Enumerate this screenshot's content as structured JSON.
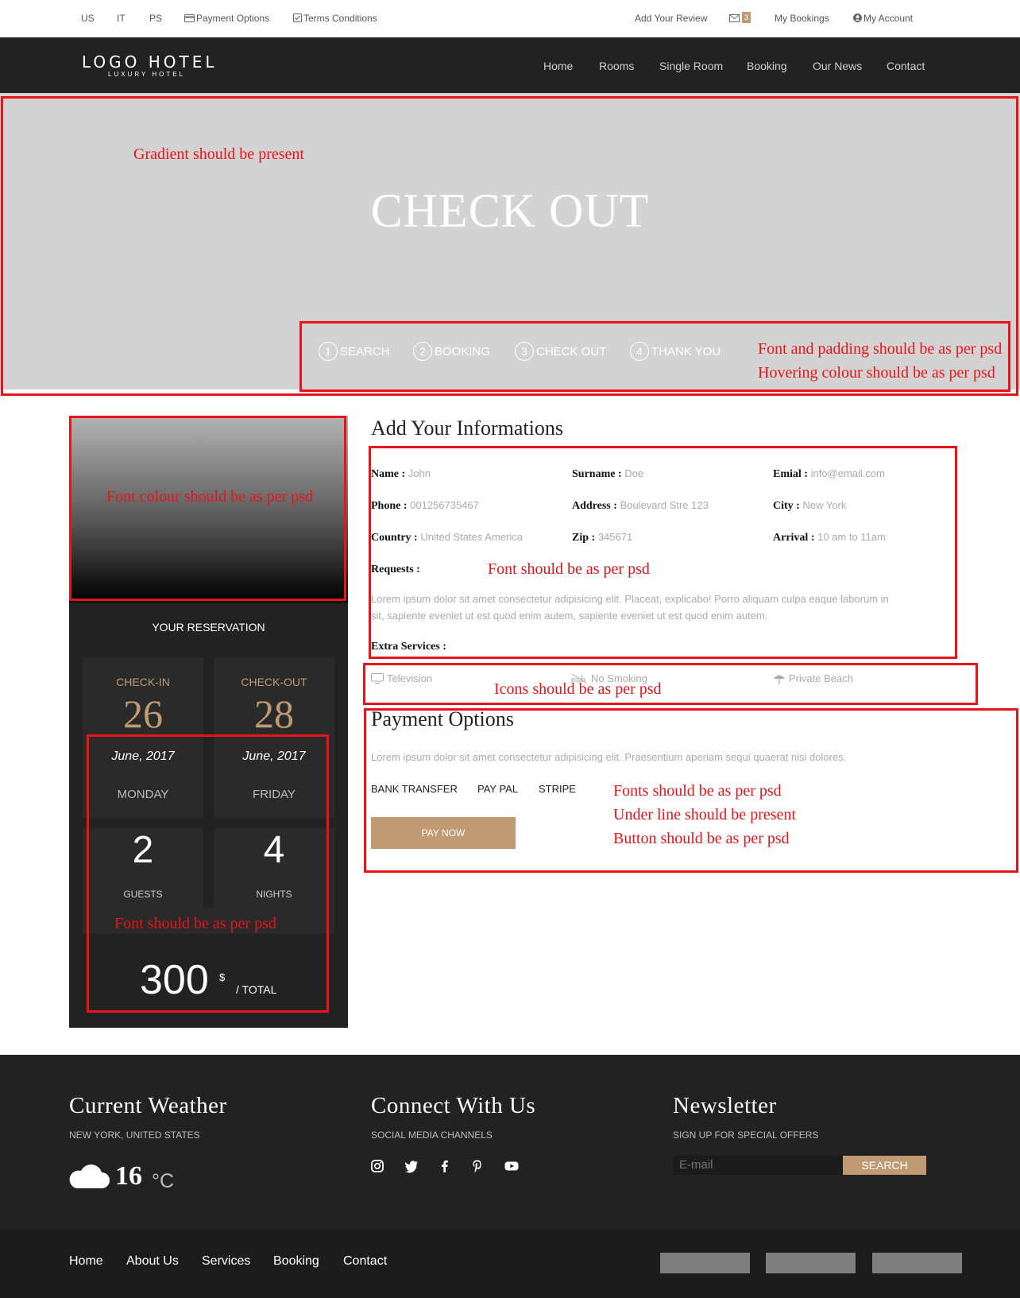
{
  "topbar": {
    "lang_us": "US",
    "lang_it": "IT",
    "lang_ps": "PS",
    "payment_options": "Payment Options",
    "terms": "Terms Conditions",
    "add_review": "Add Your Review",
    "mail_count": "3",
    "my_bookings": "My Bookings",
    "my_account": "My Account"
  },
  "navbar": {
    "logo": "LOGO HOTEL",
    "logo_sub": "LUXURY HOTEL",
    "items": [
      "Home",
      "Rooms",
      "Single Room",
      "Booking",
      "Our News",
      "Contact"
    ]
  },
  "hero": {
    "title": "CHECK OUT",
    "steps": [
      {
        "num": "1",
        "label": "SEARCH"
      },
      {
        "num": "2",
        "label": "BOOKING"
      },
      {
        "num": "3",
        "label": "CHECK OUT"
      },
      {
        "num": "4",
        "label": "THANK YOU"
      }
    ]
  },
  "notes": {
    "gradient": "Gradient should be present",
    "font_padding": "Font and padding should be as per psd",
    "hover_colour": "Hovering colour should be as per psd",
    "font_colour": "Font colour should be as per psd",
    "font_info": "Font should be as per psd",
    "icons": "Icons should be as per psd",
    "fonts_pay": "Fonts should be as per psd",
    "underline": "Under line should be present",
    "button": "Button should be as per psd",
    "font_total": "Font should be as per psd"
  },
  "reservation": {
    "title": "YOUR RESERVATION",
    "checkin_label": "CHECK-IN",
    "checkin_day": "26",
    "checkin_month": "June, 2017",
    "checkin_weekday": "MONDAY",
    "checkout_label": "CHECK-OUT",
    "checkout_day": "28",
    "checkout_month": "June, 2017",
    "checkout_weekday": "FRIDAY",
    "guests": "2",
    "guests_label": "GUESTS",
    "nights": "4",
    "nights_label": "NIGHTS",
    "total": "300",
    "currency": "$",
    "total_label": "/ TOTAL"
  },
  "info": {
    "title": "Add Your Informations",
    "name_label": "Name :",
    "name": "John",
    "surname_label": "Surname :",
    "surname": "Doe",
    "email_label": "Emial :",
    "email": "info@email.com",
    "phone_label": "Phone :",
    "phone": "001256735467",
    "address_label": "Address :",
    "address": "Boulevard Stre 123",
    "city_label": "City :",
    "city": "New York",
    "country_label": "Country :",
    "country": "United States America",
    "zip_label": "Zip :",
    "zip": "345671",
    "arrival_label": "Arrival :",
    "arrival": "10 am to 11am",
    "requests_label": "Requests :",
    "requests_text_1": "Lorem ipsum dolor sit amet consectetur adipisicing elit. Placeat, explicabo! Porro aliquam culpa eaque laborum in",
    "requests_text_2": "sit, sapiente eveniet ut est quod enim autem, sapiente eveniet ut est quod enim autem.",
    "extra_label": "Extra Services :",
    "services": [
      "Television",
      "No Smoking",
      "Private Beach"
    ]
  },
  "payment": {
    "title": "Payment Options",
    "text": "Lorem ipsum dolor sit amet consectetur adipisicing elit. Praesentium aperiam sequi quaerat nisi dolores.",
    "options": [
      "BANK TRANSFER",
      "PAY PAL",
      "STRIPE"
    ],
    "pay_now": "PAY NOW"
  },
  "footer": {
    "weather_title": "Current Weather",
    "weather_sub": "NEW YORK, UNITED STATES",
    "temperature": "16",
    "temp_unit": "°C",
    "connect_title": "Connect With Us",
    "connect_sub": "SOCIAL MEDIA CHANNELS",
    "social_icons": [
      "instagram-icon",
      "twitter-icon",
      "facebook-icon",
      "pinterest-icon",
      "youtube-icon"
    ],
    "newsletter_title": "Newsletter",
    "newsletter_sub": "SIGN UP FOR SPECIAL OFFERS",
    "email_placeholder": "E-mail",
    "search_button": "SEARCH",
    "bottom_links": [
      "Home",
      "About Us",
      "Services",
      "Booking",
      "Contact"
    ]
  },
  "colors": {
    "accent": "#c09a72",
    "dark": "#222222",
    "annotation": "#e8141a",
    "hero_bg": "#d3d3d3"
  }
}
